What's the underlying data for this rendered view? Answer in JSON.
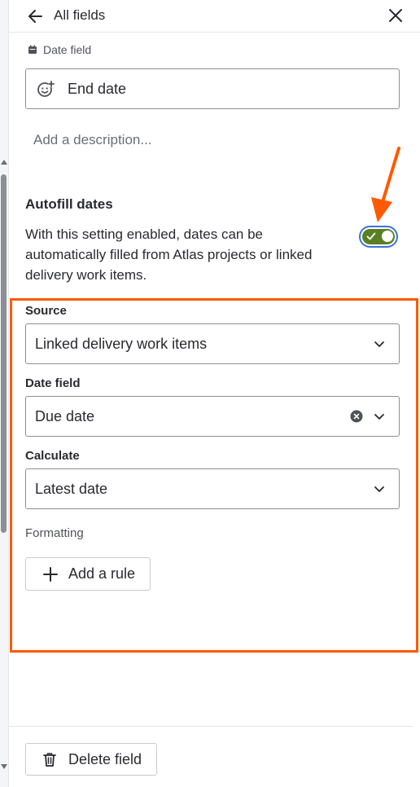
{
  "header": {
    "title": "All fields",
    "back_icon": "arrow-left-icon",
    "close_icon": "close-icon"
  },
  "field": {
    "type_label": "Date field",
    "type_icon": "calendar-icon",
    "name_value": "End date",
    "name_icon": "emoji-add-icon",
    "description_placeholder": "Add a description..."
  },
  "autofill": {
    "heading": "Autofill dates",
    "description": "With this setting enabled, dates can be automatically filled from Atlas projects or linked delivery work items.",
    "enabled": true,
    "toggle_color": "#5b7f24"
  },
  "settings": {
    "source": {
      "label": "Source",
      "value": "Linked delivery work items"
    },
    "date_field": {
      "label": "Date field",
      "value": "Due date"
    },
    "calculate": {
      "label": "Calculate",
      "value": "Latest date"
    },
    "formatting_label": "Formatting",
    "add_rule_label": "Add a rule"
  },
  "footer": {
    "delete_label": "Delete field"
  },
  "annotation": {
    "color": "#ff5a00"
  }
}
